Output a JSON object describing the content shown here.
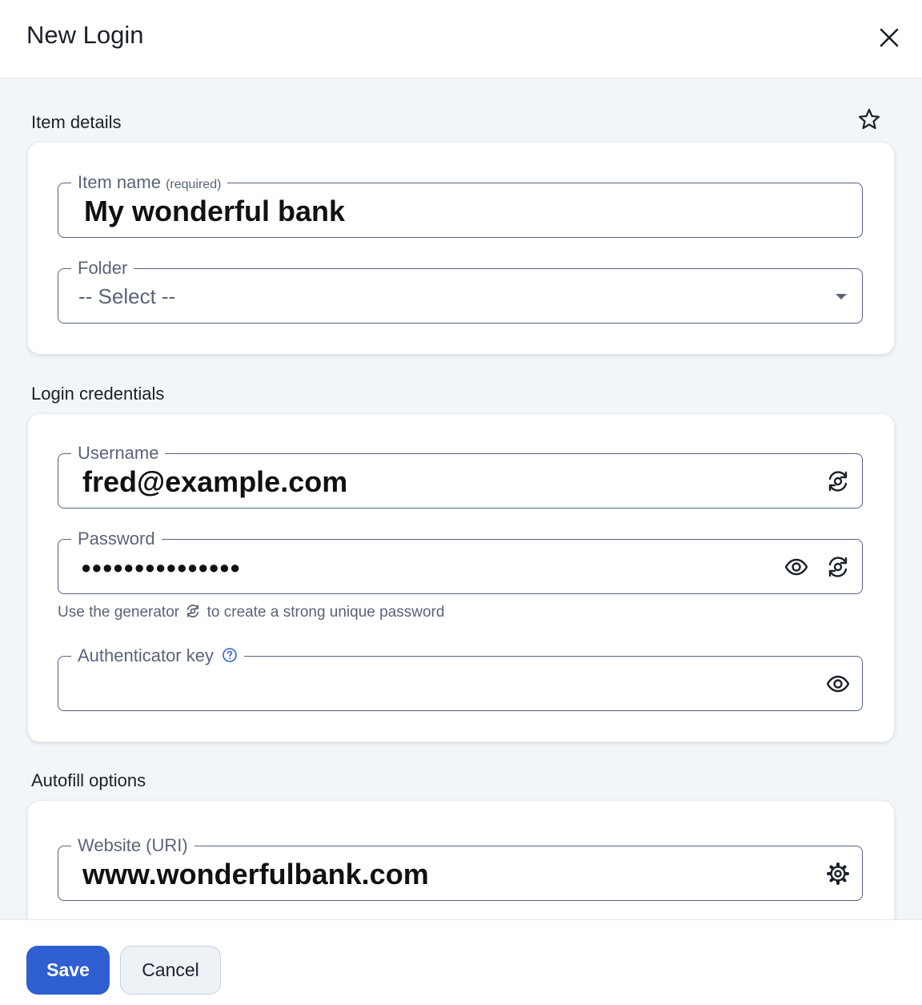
{
  "header": {
    "title": "New Login",
    "close_icon": "close-icon"
  },
  "item_details": {
    "heading": "Item details",
    "favorite_icon": "star-icon",
    "item_name": {
      "label": "Item name",
      "required": "(required)",
      "value": "My wonderful bank"
    },
    "folder": {
      "label": "Folder",
      "selected": "-- Select --",
      "icon": "chevron-down-icon"
    }
  },
  "login_credentials": {
    "heading": "Login credentials",
    "username": {
      "label": "Username",
      "value": "fred@example.com",
      "icon": "generator-icon"
    },
    "password": {
      "label": "Password",
      "masked_value": "●●●●●●●●●●●●●●●",
      "icons": [
        "eye-icon",
        "generator-icon"
      ]
    },
    "hint": {
      "before": "Use the generator",
      "after": "to create a strong unique password"
    },
    "authenticator_key": {
      "label": "Authenticator key",
      "value": "",
      "icons": [
        "help-icon",
        "eye-icon"
      ]
    }
  },
  "autofill_options": {
    "heading": "Autofill options",
    "website": {
      "label": "Website (URI)",
      "value": "www.wonderfulbank.com",
      "icon": "gear-icon"
    }
  },
  "footer": {
    "save_label": "Save",
    "cancel_label": "Cancel"
  },
  "colors": {
    "primary": "#2f5fd1",
    "border": "#566282",
    "muted_text": "#5a6478",
    "background": "#f3f6f9"
  }
}
